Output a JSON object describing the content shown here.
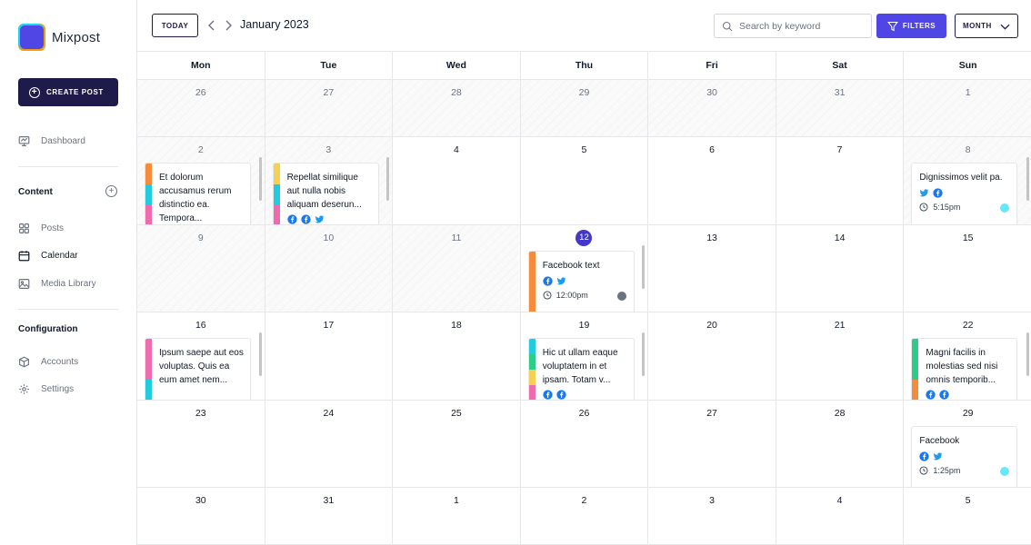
{
  "app": {
    "name": "Mixpost"
  },
  "sidebar": {
    "create_post_label": "CREATE POST",
    "dashboard_label": "Dashboard",
    "content_title": "Content",
    "posts_label": "Posts",
    "calendar_label": "Calendar",
    "media_label": "Media Library",
    "config_title": "Configuration",
    "accounts_label": "Accounts",
    "settings_label": "Settings"
  },
  "toolbar": {
    "today_label": "TODAY",
    "month_title": "January 2023",
    "search_placeholder": "Search by keyword",
    "filters_label": "FILTERS",
    "view_label": "MONTH"
  },
  "calendar": {
    "weekdays": [
      "Mon",
      "Tue",
      "Wed",
      "Thu",
      "Fri",
      "Sat",
      "Sun"
    ],
    "days": [
      "26",
      "27",
      "28",
      "29",
      "30",
      "31",
      "1",
      "2",
      "3",
      "4",
      "5",
      "6",
      "7",
      "8",
      "9",
      "10",
      "11",
      "12",
      "13",
      "14",
      "15",
      "16",
      "17",
      "18",
      "19",
      "20",
      "21",
      "22",
      "23",
      "24",
      "25",
      "26",
      "27",
      "28",
      "29",
      "30",
      "31",
      "1",
      "2",
      "3",
      "4",
      "5"
    ],
    "today": "12"
  },
  "colors": {
    "accent": "#4f46e5",
    "dark": "#1e1b4b",
    "orange": "#f58b3b",
    "cyan": "#22ccdf",
    "pink": "#ee6bae",
    "yellow": "#f6d052",
    "green": "#2ecc8b",
    "facebook": "#1877f2",
    "twitter": "#1d9bf0",
    "dot_cyan": "#67e8f9",
    "dot_gray": "#6b7280"
  },
  "posts": {
    "p1": {
      "text": "Et dolorum accusamus rerum distinctio ea. Tempora..."
    },
    "p2": {
      "text": "Repellat similique aut nulla nobis aliquam deserun..."
    },
    "p3": {
      "text": "Dignissimos velit pa.",
      "time": "5:15pm"
    },
    "p4": {
      "text": "Facebook text",
      "time": "12:00pm"
    },
    "p5": {
      "text": "Ipsum saepe aut eos voluptas. Quis ea eum amet nem..."
    },
    "p6": {
      "text": "Hic ut ullam eaque voluptatem in et ipsam. Totam v..."
    },
    "p7": {
      "text": "Magni facilis in molestias sed nisi omnis temporib..."
    },
    "p8": {
      "text": "Facebook",
      "time": "1:25pm"
    }
  }
}
